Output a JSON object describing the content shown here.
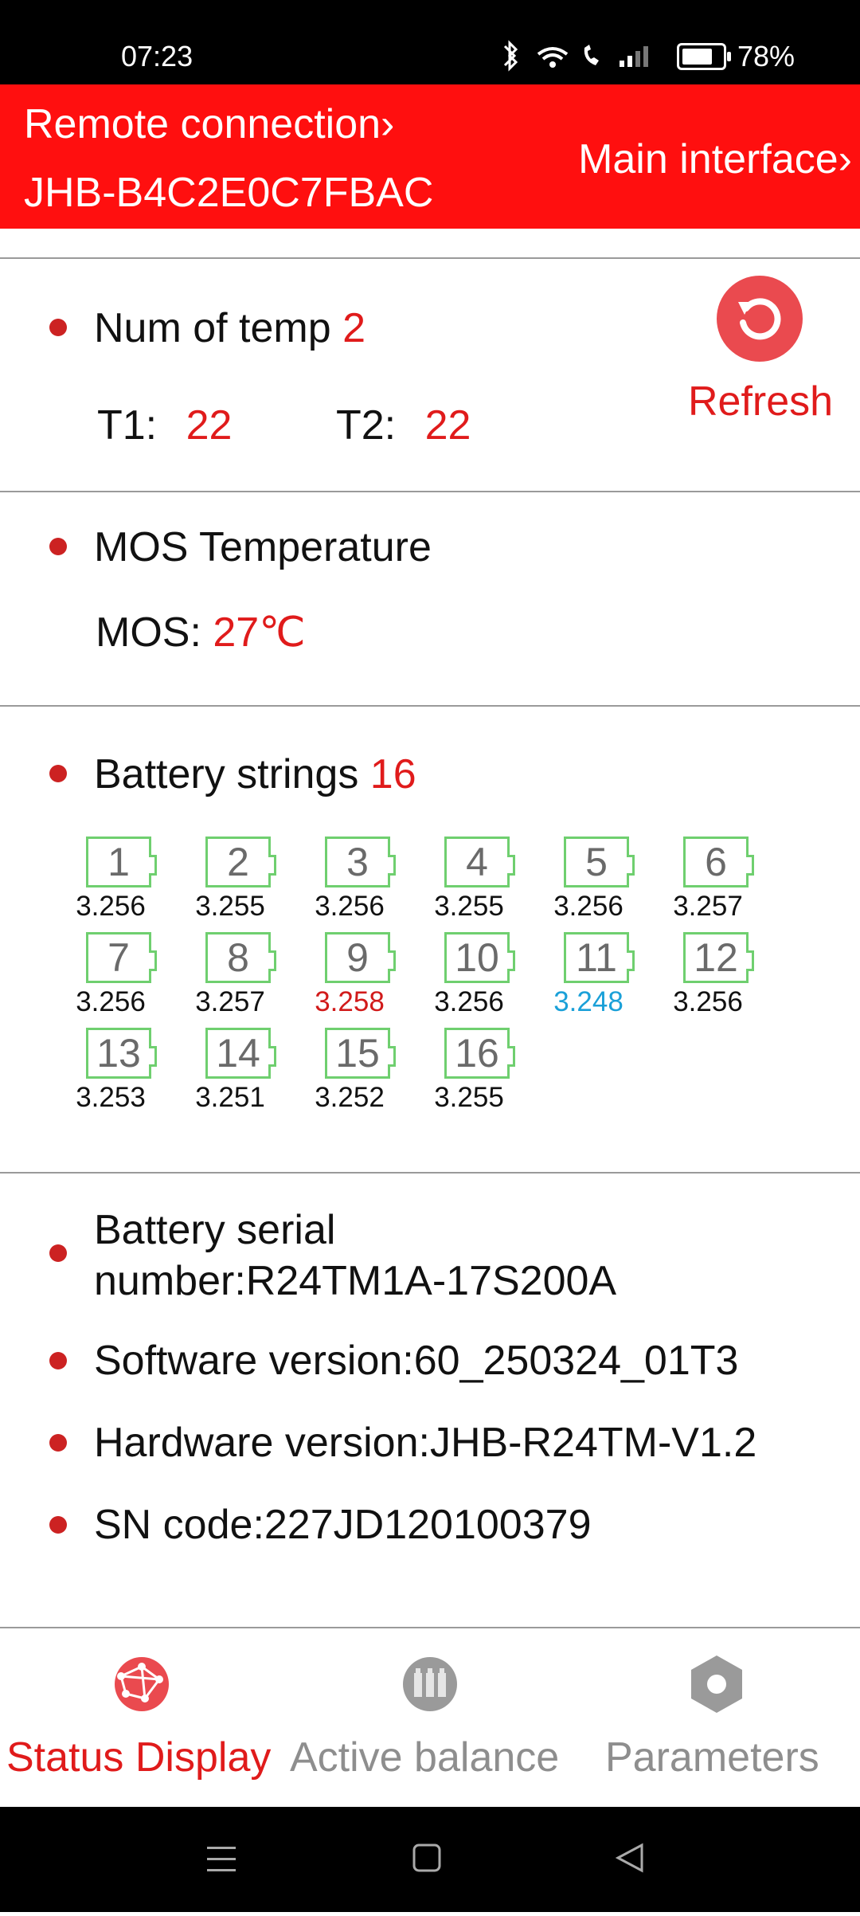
{
  "status_bar": {
    "time": "07:23",
    "battery_percent": "78%",
    "battery_level": 0.78
  },
  "header": {
    "remote_connection": "Remote connection",
    "device_id": "JHB-B4C2E0C7FBAC",
    "main_interface": "Main interface",
    "chevron": "›"
  },
  "temperature": {
    "title": "Num of temp",
    "count": "2",
    "t1_label": "T1:",
    "t1_value": "22",
    "t2_label": "T2:",
    "t2_value": "22",
    "refresh_label": "Refresh"
  },
  "mos": {
    "title": "MOS Temperature",
    "label": "MOS:",
    "value": "27℃"
  },
  "strings": {
    "title": "Battery strings",
    "count": "16",
    "cells": [
      {
        "n": "1",
        "v": "3.256"
      },
      {
        "n": "2",
        "v": "3.255"
      },
      {
        "n": "3",
        "v": "3.256"
      },
      {
        "n": "4",
        "v": "3.255"
      },
      {
        "n": "5",
        "v": "3.256"
      },
      {
        "n": "6",
        "v": "3.257"
      },
      {
        "n": "7",
        "v": "3.256"
      },
      {
        "n": "8",
        "v": "3.257"
      },
      {
        "n": "9",
        "v": "3.258"
      },
      {
        "n": "10",
        "v": "3.256"
      },
      {
        "n": "11",
        "v": "3.248"
      },
      {
        "n": "12",
        "v": "3.256"
      },
      {
        "n": "13",
        "v": "3.253"
      },
      {
        "n": "14",
        "v": "3.251"
      },
      {
        "n": "15",
        "v": "3.252"
      },
      {
        "n": "16",
        "v": "3.255"
      }
    ],
    "colors": {
      "cell_border": "#6fcf6f",
      "highest": "#d11a1a",
      "lowest": "#1aa0d8"
    }
  },
  "info": {
    "serial_line1": "Battery serial",
    "serial_line2": "number:R24TM1A-17S200A",
    "software": "Software version:60_250324_01T3",
    "hardware": "Hardware version:JHB-R24TM-V1.2",
    "sn": "SN code:227JD120100379"
  },
  "bottom_nav": {
    "status": "Status Display",
    "balance": "Active balance",
    "parameters": "Parameters",
    "active_color": "#e01b1b",
    "inactive_color": "#8e8e8e"
  },
  "colors": {
    "accent": "#ff0f0f",
    "value_red": "#e01b1b"
  }
}
